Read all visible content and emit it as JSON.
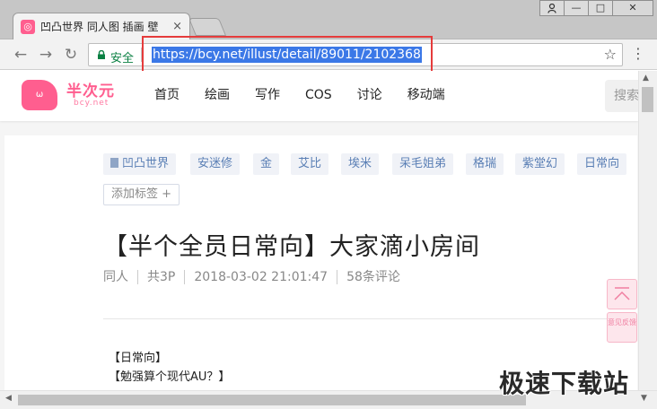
{
  "browser": {
    "tab_title": "凹凸世界 同人图 插画 壁",
    "tab_close": "×",
    "favicon": "bcy-favicon",
    "window_controls": {
      "user": "user-icon",
      "minimize": "—",
      "maximize": "□",
      "close": "✕"
    },
    "back": "←",
    "forward": "→",
    "reload": "↻",
    "secure_label": "安全",
    "url": "https://bcy.net/illust/detail/89011/2102368",
    "star": "☆",
    "menu": "⋮"
  },
  "site": {
    "logo_badge": "ω",
    "logo_cn": "半次元",
    "logo_en": "bcy.net",
    "nav": [
      {
        "label": "首页"
      },
      {
        "label": "绘画"
      },
      {
        "label": "写作"
      },
      {
        "label": "COS"
      },
      {
        "label": "讨论"
      },
      {
        "label": "移动端"
      }
    ],
    "search_placeholder": "搜索"
  },
  "post": {
    "tags": [
      {
        "label": "凹凸世界"
      },
      {
        "label": "安迷修"
      },
      {
        "label": "金"
      },
      {
        "label": "艾比"
      },
      {
        "label": "埃米"
      },
      {
        "label": "呆毛姐弟"
      },
      {
        "label": "格瑞"
      },
      {
        "label": "紫堂幻"
      },
      {
        "label": "日常向"
      }
    ],
    "add_tag": "添加标签 +",
    "title": "【半个全员日常向】大家滴小房间",
    "meta": {
      "category": "同人",
      "pages": "共3P",
      "datetime": "2018-03-02 21:01:47",
      "comments": "58条评论"
    },
    "body": [
      "【日常向】",
      "【勉强算个现代AU？】"
    ]
  },
  "floating": {
    "feedback": "意见反馈"
  },
  "watermark": "极速下载站",
  "colors": {
    "brand": "#ff5e8f",
    "tag_text": "#5a7fb5",
    "secure": "#0b8043",
    "selection": "#3b78e7",
    "highlight": "#e53b3b"
  }
}
